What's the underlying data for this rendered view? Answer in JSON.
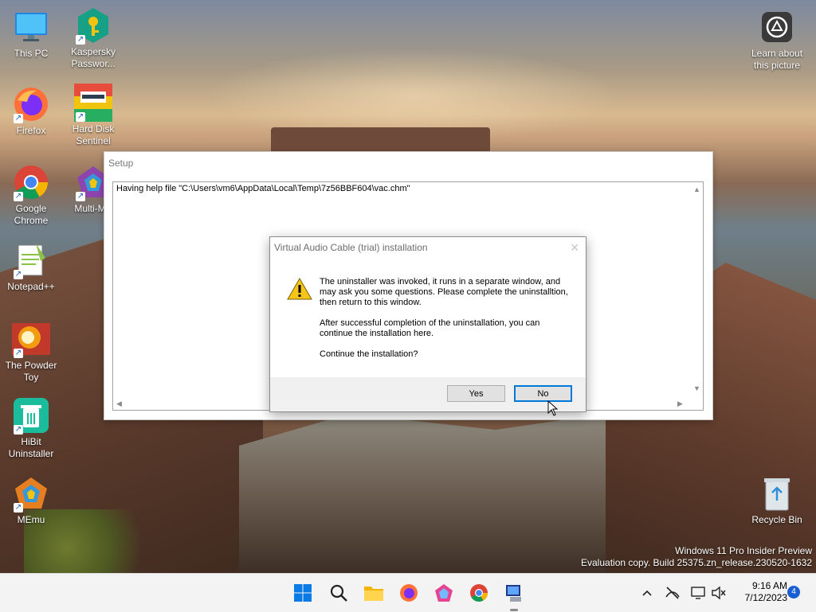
{
  "desktop": {
    "icons": [
      {
        "label": "This PC"
      },
      {
        "label": "Kaspersky Passwor..."
      },
      {
        "label": "Learn about this picture"
      },
      {
        "label": "Firefox"
      },
      {
        "label": "Hard Disk Sentinel"
      },
      {
        "label": "Google Chrome"
      },
      {
        "label": "Multi-ME"
      },
      {
        "label": "Notepad++"
      },
      {
        "label": "The Powder Toy"
      },
      {
        "label": "HiBit Uninstaller"
      },
      {
        "label": "MEmu"
      },
      {
        "label": "Recycle Bin"
      }
    ],
    "watermark": {
      "line1": "Windows 11 Pro Insider Preview",
      "line2": "Evaluation copy. Build 25375.zn_release.230520-1632"
    }
  },
  "setup_window": {
    "title": "Setup",
    "log_line": "Having help file \"C:\\Users\\vm6\\AppData\\Local\\Temp\\7z56BBF604\\vac.chm\""
  },
  "dialog": {
    "title": "Virtual Audio Cable (trial) installation",
    "paragraph1": "The uninstaller was invoked, it runs in a separate window, and may ask you some questions. Please complete the uninstalltion, then return to this window.",
    "paragraph2": "After successful completion of the uninstallation, you can continue the installation here.",
    "question": "Continue the installation?",
    "yes_label": "Yes",
    "no_label": "No",
    "icon": "warning-icon"
  },
  "taskbar": {
    "pinned": [
      "start-icon",
      "search-icon",
      "file-explorer-icon",
      "firefox-icon",
      "memu-icon",
      "chrome-icon",
      "setup-app-icon"
    ],
    "tray": [
      "chevron-up-icon",
      "network-off-icon",
      "display-icon",
      "volume-muted-icon"
    ],
    "time": "9:16 AM",
    "date": "7/12/2023",
    "notification_count": "4"
  }
}
